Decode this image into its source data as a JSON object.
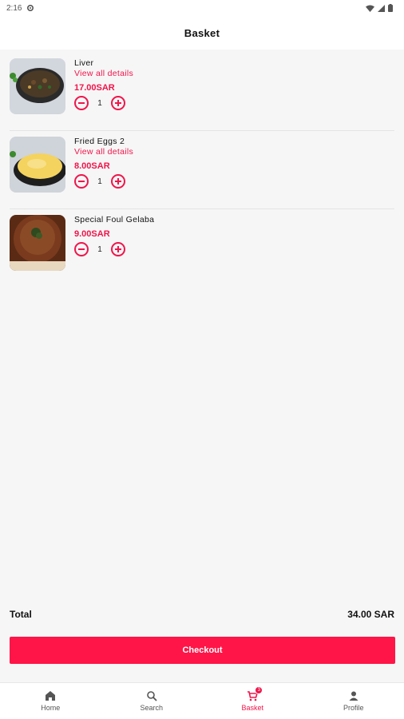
{
  "status_bar": {
    "time": "2:16"
  },
  "header": {
    "title": "Basket"
  },
  "basket": {
    "items": [
      {
        "name": "Liver",
        "details_link": "View all details",
        "price": "17.00SAR",
        "quantity": "1"
      },
      {
        "name": "Fried Eggs 2",
        "details_link": "View all details",
        "price": "8.00SAR",
        "quantity": "1"
      },
      {
        "name": "Special Foul Gelaba",
        "price": "9.00SAR",
        "quantity": "1"
      }
    ]
  },
  "summary": {
    "total_label": "Total",
    "total_value": "34.00 SAR"
  },
  "checkout_label": "Checkout",
  "bottom_nav": {
    "items": [
      {
        "label": "Home",
        "icon": "home-icon"
      },
      {
        "label": "Search",
        "icon": "search-icon"
      },
      {
        "label": "Basket",
        "icon": "cart-icon",
        "badge": "3",
        "active": true
      },
      {
        "label": "Profile",
        "icon": "person-icon"
      }
    ]
  },
  "colors": {
    "accent": "#f0154a",
    "button": "#ff1547",
    "background": "#f6f6f6"
  }
}
